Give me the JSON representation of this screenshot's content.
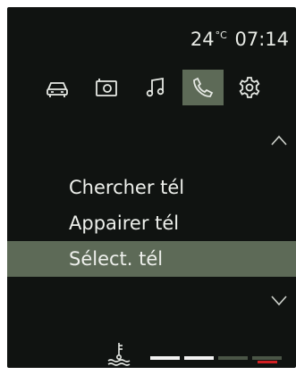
{
  "status": {
    "temperature_value": "24",
    "temperature_unit": "°C",
    "time": "07:14"
  },
  "tabs": [
    {
      "icon": "car-icon"
    },
    {
      "icon": "radio-icon"
    },
    {
      "icon": "music-note-icon"
    },
    {
      "icon": "phone-icon",
      "active": true
    },
    {
      "icon": "gear-icon"
    }
  ],
  "menu": {
    "items": [
      {
        "label": "Chercher tél"
      },
      {
        "label": "Appairer tél"
      },
      {
        "label": "Sélect. tél",
        "selected": true
      }
    ]
  },
  "engine_temp_gauge": {
    "icon": "coolant-temperature-icon",
    "level_segments_on": 2,
    "segments_total": 4,
    "colors": {
      "on": "#f2f2f2",
      "off": "#4a5546",
      "warning": "#d31f22"
    }
  },
  "colors": {
    "background": "#101311",
    "selected": "#5d6a57",
    "text": "#eef0ec"
  }
}
